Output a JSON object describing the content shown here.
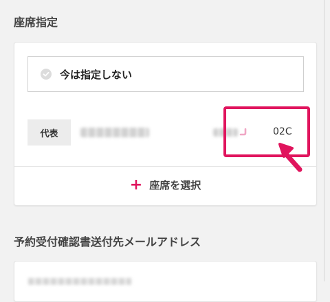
{
  "seat_section": {
    "title": "座席指定",
    "no_select_label": "今は指定しない",
    "passenger": {
      "badge": "代表",
      "seat_number": "02C"
    },
    "select_seat_label": "座席を選択",
    "plus_symbol": "+"
  },
  "email_section": {
    "title": "予約受付確認書送付先メールアドレス"
  },
  "colors": {
    "accent": "#e0145d",
    "seat_icon": "#f0a6c4"
  }
}
